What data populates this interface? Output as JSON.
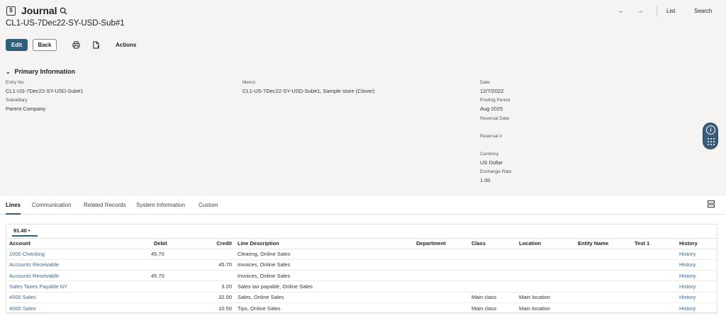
{
  "header": {
    "record_type": "Journal",
    "record_title": "CL1-US-7Dec22-SY-USD-Sub#1",
    "icon_letter": "$",
    "nav_prev": "←",
    "nav_next": "→",
    "list_label": "List",
    "search_label": "Search"
  },
  "toolbar": {
    "edit_label": "Edit",
    "back_label": "Back",
    "actions_label": "Actions"
  },
  "primary": {
    "section_title": "Primary Information",
    "entry_no_label": "Entry No.",
    "entry_no_value": "CL1-US-7Dec22-SY-USD-Sub#1",
    "subsidiary_label": "Subsidiary",
    "subsidiary_value": "Parent Company",
    "memo_label": "Memo",
    "memo_value": "CL1-US-7Dec22-SY-USD-Sub#1, Sample store (Clover)",
    "date_label": "Date",
    "date_value": "12/7/2022",
    "posting_period_label": "Posting Period",
    "posting_period_value": "Aug 2025",
    "reversal_date_label": "Reversal Date",
    "reversal_no_label": "Reversal #",
    "currency_label": "Currency",
    "currency_value": "US Dollar",
    "exchange_rate_label": "Exchange Rate",
    "exchange_rate_value": "1.00"
  },
  "tabs": [
    {
      "label": "Lines"
    },
    {
      "label": "Communication"
    },
    {
      "label": "Related Records"
    },
    {
      "label": "System Information"
    },
    {
      "label": "Custom"
    }
  ],
  "lines": {
    "subtab_label": "91.40 •",
    "columns": {
      "account": "Account",
      "debit": "Debit",
      "credit": "Credit",
      "line_description": "Line Description",
      "department": "Department",
      "class": "Class",
      "location": "Location",
      "entity_name": "Entity Name",
      "test1": "Test 1",
      "history": "History"
    },
    "rows": [
      {
        "account": "1000 Checking",
        "debit": "45.70",
        "credit": "",
        "desc": "Clearing, Online Sales",
        "department": "",
        "class": "",
        "location": "",
        "entity": "",
        "test1": "",
        "history": "History"
      },
      {
        "account": "Accounts Receivable",
        "debit": "",
        "credit": "45.70",
        "desc": "Invoices, Online Sales",
        "department": "",
        "class": "",
        "location": "",
        "entity": "",
        "test1": "",
        "history": "History"
      },
      {
        "account": "Accounts Receivable",
        "debit": "45.70",
        "credit": "",
        "desc": "Invoices, Online Sales",
        "department": "",
        "class": "",
        "location": "",
        "entity": "",
        "test1": "",
        "history": "History"
      },
      {
        "account": "Sales Taxes Payable NY",
        "debit": "",
        "credit": "3.20",
        "desc": "Sales tax payable, Online Sales",
        "department": "",
        "class": "",
        "location": "",
        "entity": "",
        "test1": "",
        "history": "History"
      },
      {
        "account": "4000 Sales",
        "debit": "",
        "credit": "32.00",
        "desc": "Sales, Online Sales",
        "department": "",
        "class": "Main class",
        "location": "Main location",
        "entity": "",
        "test1": "",
        "history": "History"
      },
      {
        "account": "4000 Sales",
        "debit": "",
        "credit": "10.50",
        "desc": "Tips, Online Sales",
        "department": "",
        "class": "Main class",
        "location": "Main location",
        "entity": "",
        "test1": "",
        "history": "History"
      }
    ]
  },
  "colors": {
    "accent": "#2f5d7c",
    "link": "#3a6a93",
    "panel_bg": "#f5f4f2"
  },
  "icons": [
    "record-type-icon",
    "search-icon",
    "print-icon",
    "new-document-icon",
    "chevron-down-icon",
    "help-icon",
    "apps-grid-icon",
    "layout-toggle-icon"
  ]
}
